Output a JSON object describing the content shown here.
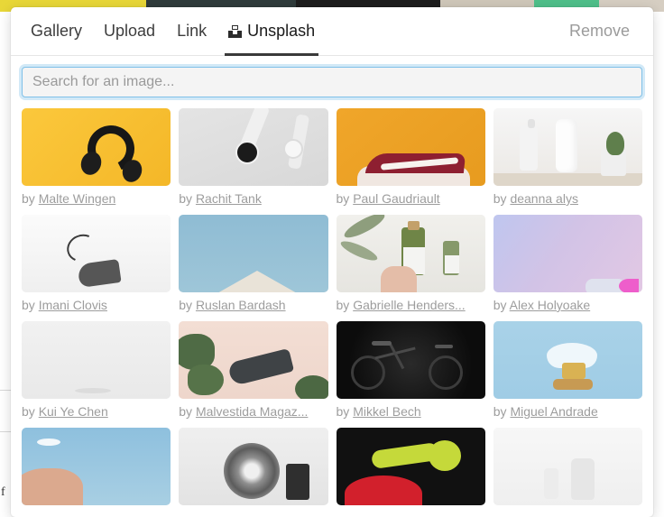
{
  "background": {
    "partial_letter": "f"
  },
  "modal": {
    "tabs": [
      {
        "label": "Gallery",
        "active": false,
        "icon": null
      },
      {
        "label": "Upload",
        "active": false,
        "icon": null
      },
      {
        "label": "Link",
        "active": false,
        "icon": null
      },
      {
        "label": "Unsplash",
        "active": true,
        "icon": "unsplash-icon"
      }
    ],
    "remove_label": "Remove",
    "search": {
      "value": "",
      "placeholder": "Search for an image..."
    },
    "credit_prefix": "by",
    "results": [
      {
        "author": "Malte Wingen",
        "art": "t-headphones"
      },
      {
        "author": "Rachit Tank",
        "art": "t-watch"
      },
      {
        "author": "Paul Gaudriault",
        "art": "t-shoe"
      },
      {
        "author": "deanna alys",
        "art": "t-cosmetic"
      },
      {
        "author": "Imani Clovis",
        "art": "t-greyshoe"
      },
      {
        "author": "Ruslan Bardash",
        "art": "t-roof"
      },
      {
        "author": "Gabrielle Henders...",
        "art": "t-bottle"
      },
      {
        "author": "Alex Holyoake",
        "art": "t-lavender"
      },
      {
        "author": "Kui Ye Chen",
        "art": "t-white"
      },
      {
        "author": "Malvestida Magaz...",
        "art": "t-monstera"
      },
      {
        "author": "Mikkel Bech",
        "art": "t-bike"
      },
      {
        "author": "Miguel Andrade",
        "art": "t-glass"
      },
      {
        "author": "",
        "art": "t-sky"
      },
      {
        "author": "",
        "art": "t-speaker"
      },
      {
        "author": "",
        "art": "t-spoon"
      },
      {
        "author": "",
        "art": "t-faint"
      }
    ]
  },
  "colors": {
    "focus_ring": "#7ec0e8",
    "active_tab_underline": "#3a3a3a",
    "credit_text": "#9d9d9d",
    "remove_text": "#9b9b9b"
  }
}
